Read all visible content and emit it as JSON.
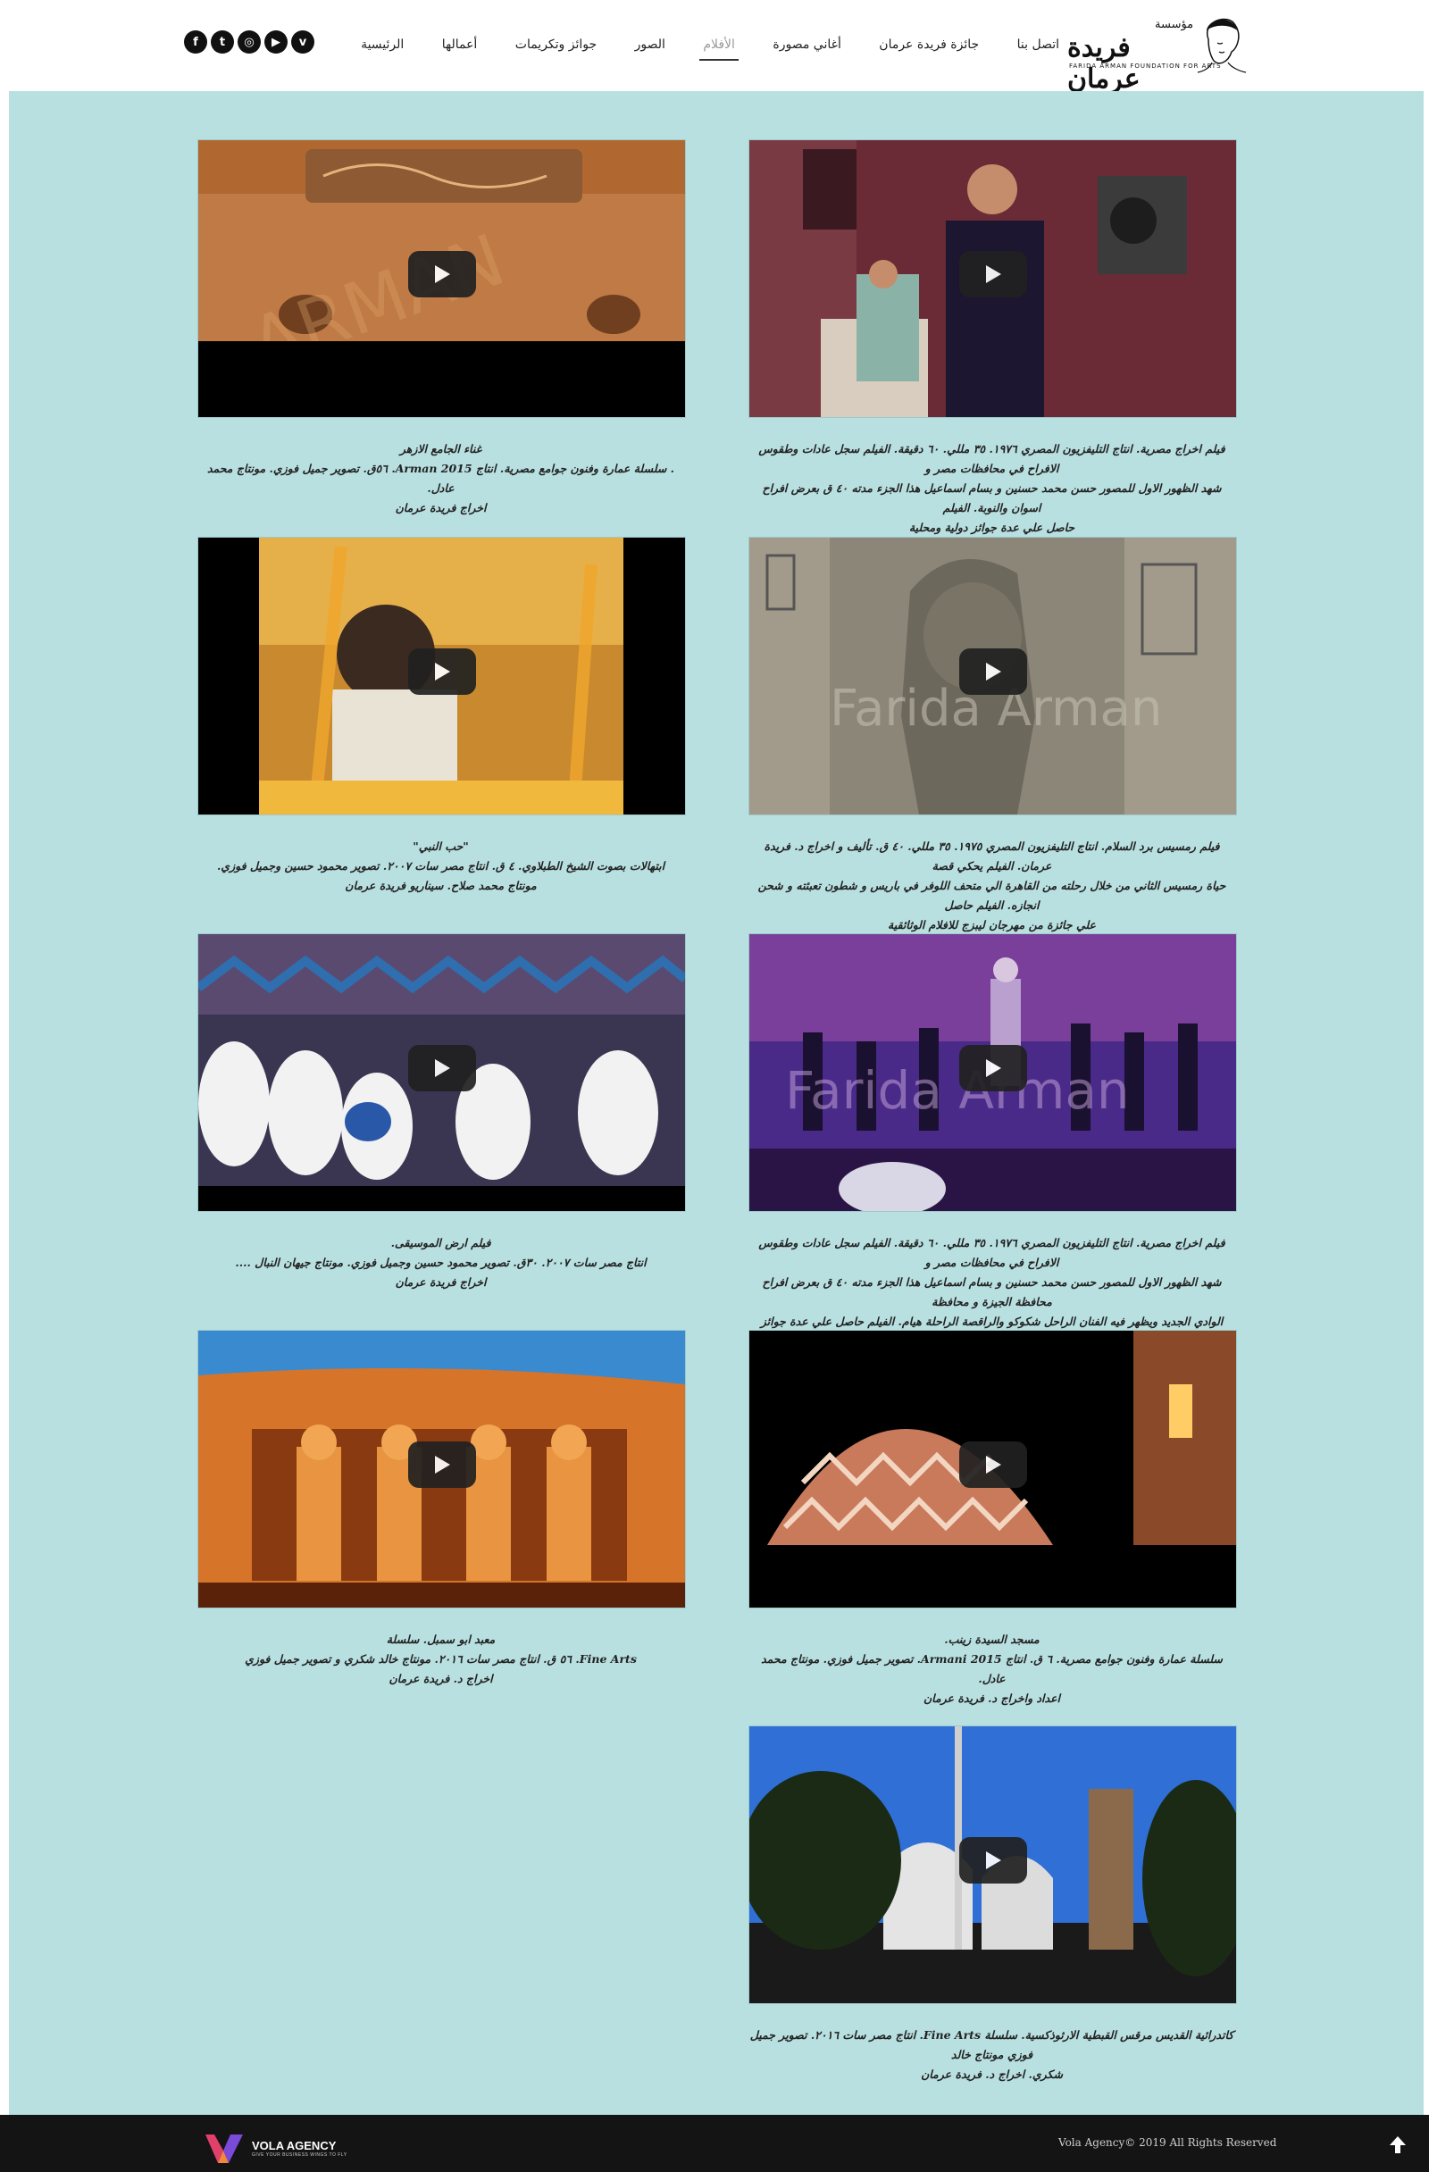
{
  "header": {
    "logo_text": "فريدة عرمان",
    "logo_small": "مؤسسة",
    "logo_sub": "FARIDA ARMAN FOUNDATION FOR ARTS",
    "nav": [
      {
        "label": "الرئيسية",
        "active": false
      },
      {
        "label": "أعمالها",
        "active": false
      },
      {
        "label": "جوائز وتكريمات",
        "active": false
      },
      {
        "label": "الصور",
        "active": false
      },
      {
        "label": "الأفلام",
        "active": true
      },
      {
        "label": "أغاني مصورة",
        "active": false
      },
      {
        "label": "جائزة فريدة عرمان",
        "active": false
      },
      {
        "label": "اتصل بنا",
        "active": false
      }
    ],
    "social": [
      {
        "icon": "facebook-icon",
        "glyph": "f"
      },
      {
        "icon": "twitter-icon",
        "glyph": "t"
      },
      {
        "icon": "instagram-icon",
        "glyph": "◎"
      },
      {
        "icon": "youtube-icon",
        "glyph": "▶"
      },
      {
        "icon": "vimeo-icon",
        "glyph": "v"
      }
    ]
  },
  "videos": [
    {
      "id": "film-reportage",
      "caption": [
        "فيلم اخراج مصرية. انتاج التليفزيون المصري ١٩٧٦. ٣٥ مللي. ٦٠ دقيقة. الفيلم سجل عادات وطقوس الافراح في محافظات مصر و",
        "شهد الظهور الاول للمصور حسن محمد حسنين و بسام اسماعيل هذا الجزء مدته ٤٠ ق بعرض افراح اسوان والنوبة. الفيلم",
        "حاصل علي عدة جوائز دولية ومحلية"
      ]
    },
    {
      "id": "azhar-singing",
      "caption": [
        "غناء الجامع الازهر",
        ". سلسلة عمارة وفنون جوامع مصرية. انتاج Arman 2015. ٥٦ق. تصوير جميل فوزي. مونتاج محمد عادل.",
        "اخراج فريدة عرمان"
      ]
    },
    {
      "id": "ramses-film",
      "caption": [
        "فيلم رمسيس برد السلام. انتاج التليفزيون المصري ١٩٧٥. ٣٥ مللي. ٤٠ ق. تأليف و اخراج د. فريدة عرمان. الفيلم يحكي قصة",
        "حياة رمسيس الثاني من خلال رحلته من القاهرة الي متحف اللوفر في باريس و شطون تعبئته و شحن انجازه. الفيلم حاصل",
        "علي جائزة من مهرجان ليبزج للافلام الوثائقية"
      ]
    },
    {
      "id": "sufi-film",
      "caption": [
        "\"حب النبي\"",
        "ابتهالات بصوت الشيخ الطبلاوي. ٤ ق. انتاج مصر سات ٢٠٠٧. تصوير محمود حسين وجميل فوزي.",
        "مونتاج محمد صلاح. سيناريو فريدة عرمان"
      ]
    },
    {
      "id": "music-concert",
      "caption": [
        "فيلم اخراج مصرية. انتاج التليفزيون المصري ١٩٧٦. ٣٥ مللي. ٦٠ دقيقة. الفيلم سجل عادات وطقوس الافراح في محافظات مصر و",
        "شهد الظهور الاول للمصور حسن محمد حسنين و بسام اسماعيل هذا الجزء مدته ٤٠ ق بعرض افراح محافظة الجيزة و محافظة",
        "الوادي الجديد ويظهر فيه الفنان الراحل شكوكو والراقصة الراحلة هيام. الفيلم حاصل علي عدة جوائز دولية ومحلية"
      ]
    },
    {
      "id": "folk-music",
      "caption": [
        "فيلم ارض الموسيقى.",
        "انتاج مصر سات ٢٠٠٧. ٣٠ق. تصوير محمود حسين وجميل فوزي. مونتاج جيهان النبال ....",
        "اخراج فريدة عرمان"
      ]
    },
    {
      "id": "rashid-mosque",
      "caption": [
        "مسجد السيدة زينب.",
        "سلسلة عمارة وفنون جوامع مصرية. ٦ ق. انتاج Armani 2015. تصوير جميل فوزي. مونتاج محمد عادل.",
        "اعداد واخراج د. فريدة عرمان"
      ]
    },
    {
      "id": "abu-simbel",
      "caption": [
        "معبد ابو سمبل. سلسلة",
        "Fine Arts. ٥٦ ق. انتاج مصر سات ٢٠١٦. مونتاج خالد شكري و تصوير جميل فوزي",
        "اخراج د. فريدة عرمان"
      ]
    },
    {
      "id": "cathedral",
      "caption": [
        "كاتدرائية القديس مرقس القبطية الارثوذكسية. سلسلة Fine Arts. انتاج مصر سات ٢٠١٦. تصوير جميل فوزي مونتاج خالد",
        "شكري. اخراج د. فريدة عرمان"
      ]
    }
  ],
  "footer": {
    "agency": "VOLA AGENCY",
    "tagline": "GIVE YOUR BUSINESS WINGS TO FLY",
    "copyright": "Vola Agency© 2019 All Rights Reserved"
  },
  "colors": {
    "background": "#b9e0e1",
    "footer": "#141414",
    "play": "#212121"
  }
}
